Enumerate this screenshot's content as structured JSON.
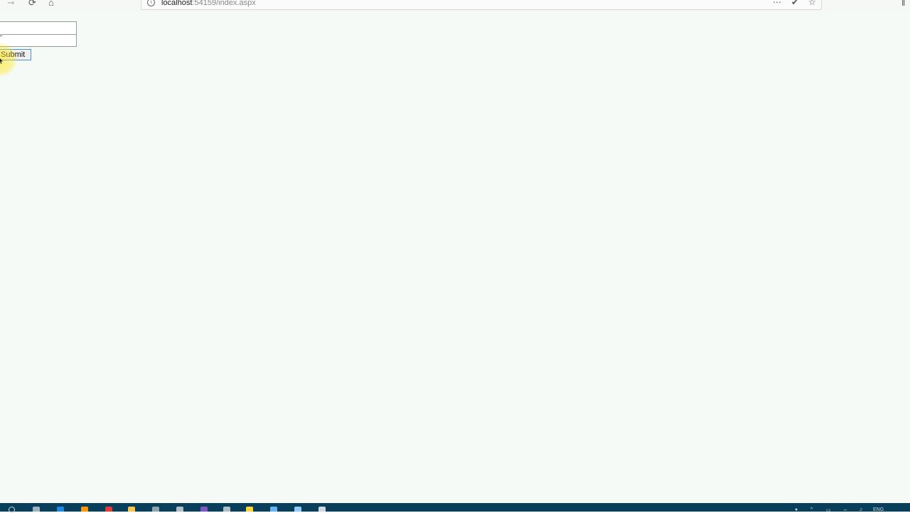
{
  "browser": {
    "url_host": "localhost",
    "url_rest": ":54159/index.aspx",
    "icons": {
      "back": "back-arrow-icon",
      "forward": "forward-arrow-icon",
      "reload": "reload-icon",
      "home": "home-icon",
      "info": "info-icon",
      "more": "more-actions-icon",
      "shield": "shield-check-icon",
      "bookmark": "star-bookmark-icon",
      "library": "library-icon"
    }
  },
  "form": {
    "text_value": "",
    "submit_label": "Submit"
  },
  "taskbar": {
    "tray_language": "ENG",
    "icons": [
      "search-icon",
      "task-view-icon",
      "edge-icon",
      "firefox-icon",
      "chrome-icon",
      "file-explorer-icon",
      "store-icon",
      "app-icon",
      "visual-studio-icon",
      "app-icon",
      "app-icon",
      "app-icon",
      "app-icon"
    ]
  },
  "colors": {
    "page_background": "#f6faf6",
    "taskbar": "#0a3f5c",
    "button_focus_border": "#4a90d9",
    "cursor_highlight": "#ffe600"
  }
}
